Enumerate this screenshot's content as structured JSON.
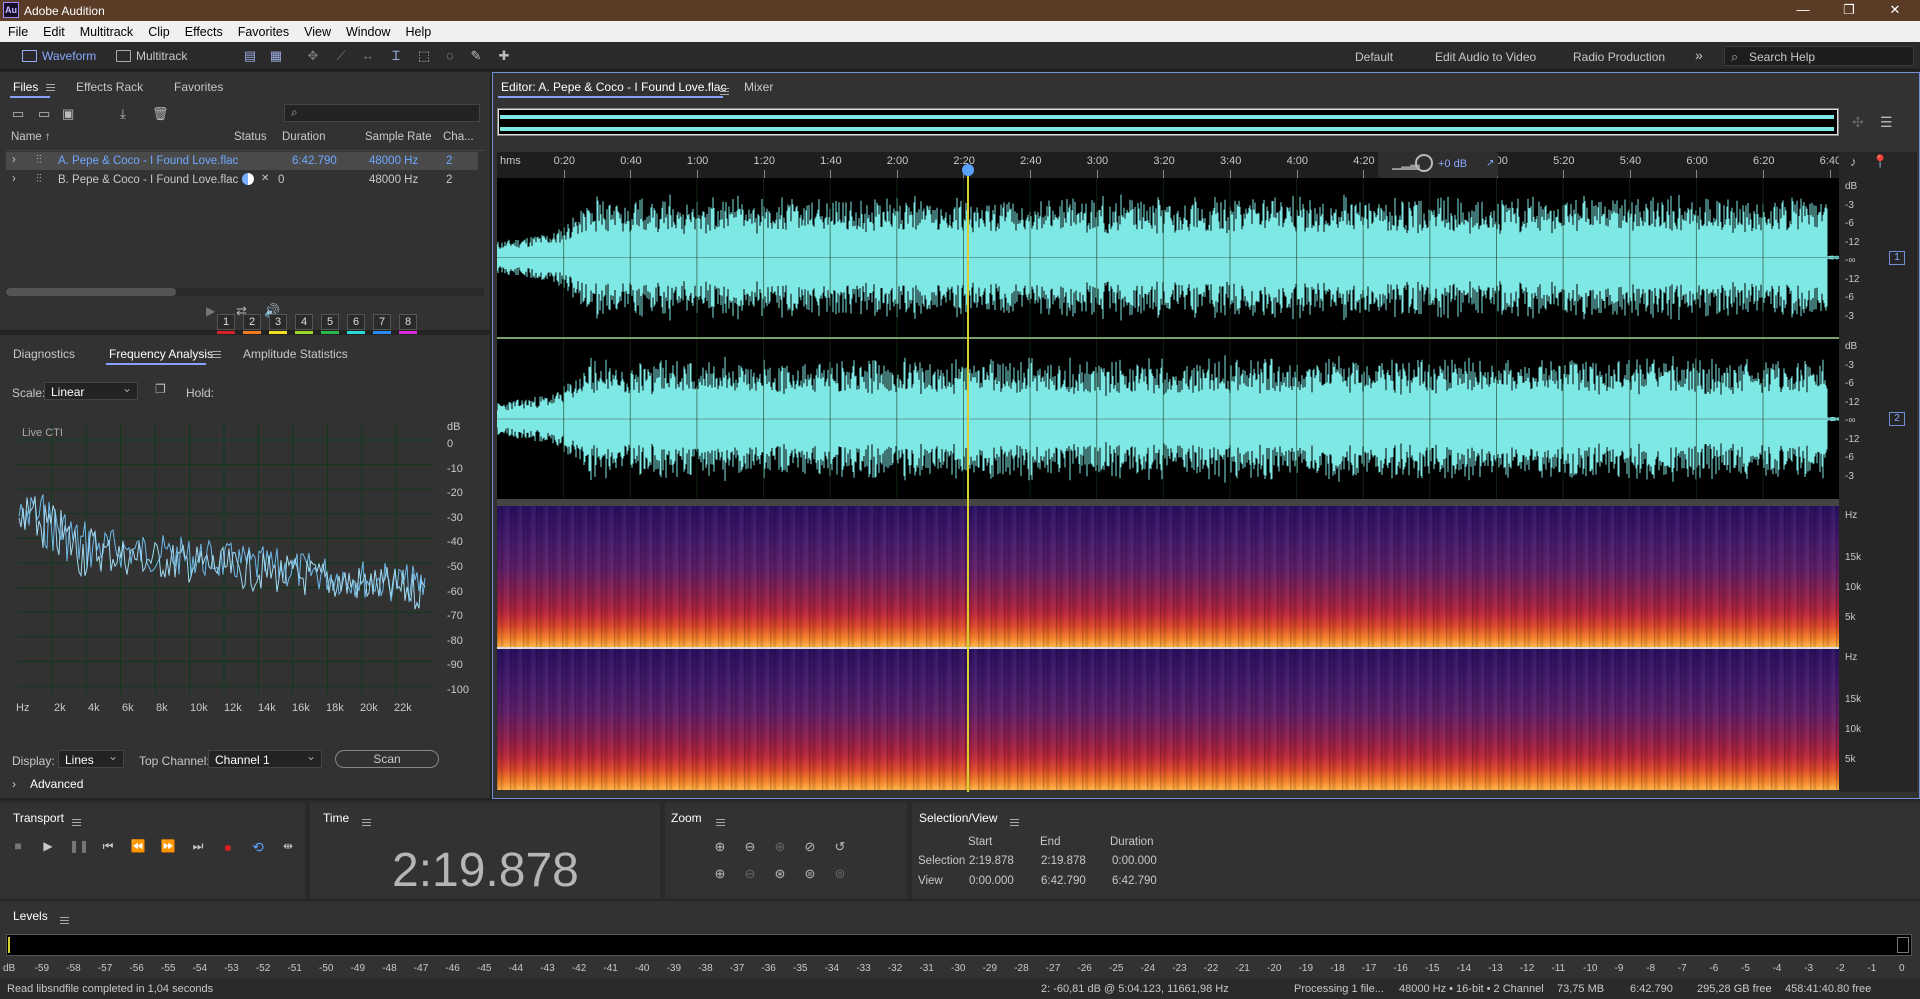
{
  "window": {
    "title": "Adobe Audition",
    "logo": "Au"
  },
  "menu": [
    "File",
    "Edit",
    "Multitrack",
    "Clip",
    "Effects",
    "Favorites",
    "View",
    "Window",
    "Help"
  ],
  "toolbar": {
    "waveform": "Waveform",
    "multitrack": "Multitrack",
    "workspaces": [
      "Default",
      "Edit Audio to Video",
      "Radio Production"
    ],
    "more": "»",
    "search_placeholder": "Search Help"
  },
  "files_panel": {
    "tabs": [
      "Files",
      "Effects Rack",
      "Favorites"
    ],
    "columns": [
      "Name ↑",
      "Status",
      "Duration",
      "Sample Rate",
      "Cha..."
    ],
    "rows": [
      {
        "name": "A. Pepe & Coco - I Found Love.flac",
        "status": "",
        "duration": "6:42.790",
        "sample_rate": "48000 Hz",
        "channels": "2",
        "selected": true
      },
      {
        "name": "B. Pepe & Coco - I Found Love.flac",
        "status": "0",
        "duration": "",
        "sample_rate": "48000 Hz",
        "channels": "2",
        "selected": false
      }
    ]
  },
  "analysis_panel": {
    "tabs": [
      "Diagnostics",
      "Frequency Analysis",
      "Amplitude Statistics"
    ],
    "scale_label": "Scale:",
    "scale_value": "Linear",
    "hold_label": "Hold:",
    "hold_buttons": [
      "1",
      "2",
      "3",
      "4",
      "5",
      "6",
      "7",
      "8"
    ],
    "hold_colors": [
      "#d8202a",
      "#f07a1e",
      "#f0e020",
      "#9ad82a",
      "#2ab84a",
      "#2ad8d8",
      "#2a8af0",
      "#d82ad8"
    ],
    "plot_label": "Live CTI",
    "db_unit": "dB",
    "db_ticks": [
      "0",
      "-10",
      "-20",
      "-30",
      "-40",
      "-50",
      "-60",
      "-70",
      "-80",
      "-90",
      "-100"
    ],
    "hz_ticks": [
      "Hz",
      "2k",
      "4k",
      "6k",
      "8k",
      "10k",
      "12k",
      "14k",
      "16k",
      "18k",
      "20k",
      "22k"
    ],
    "display_label": "Display:",
    "display_value": "Lines",
    "top_channel_label": "Top Channel:",
    "top_channel_value": "Channel 1",
    "scan_button": "Scan",
    "advanced": "Advanced"
  },
  "editor": {
    "tab": "Editor: A. Pepe & Coco - I Found Love.flac",
    "mixer_tab": "Mixer",
    "ruler_unit": "hms",
    "ruler_ticks": [
      "0:20",
      "0:40",
      "1:00",
      "1:20",
      "1:40",
      "2:00",
      "2:20",
      "2:40",
      "3:00",
      "3:20",
      "3:40",
      "4:00",
      "4:20",
      "4:40",
      "5:00",
      "5:20",
      "5:40",
      "6:00",
      "6:20",
      "6:40"
    ],
    "hud_gain": "+0 dB",
    "db_scale": [
      "dB",
      "-3",
      "-6",
      "-12",
      "-∞",
      "-12",
      "-6",
      "-3"
    ],
    "hz_scale": [
      "Hz",
      "15k",
      "10k",
      "5k"
    ],
    "channels": [
      "1",
      "2"
    ],
    "waveform_color": "#7ee8e4",
    "playhead_fraction": 0.35
  },
  "transport": {
    "title": "Transport"
  },
  "time_panel": {
    "title": "Time",
    "value": "2:19.878"
  },
  "zoom_panel": {
    "title": "Zoom"
  },
  "selection_view": {
    "title": "Selection/View",
    "headers": [
      "Start",
      "End",
      "Duration"
    ],
    "selection_label": "Selection",
    "selection": [
      "2:19.878",
      "2:19.878",
      "0:00.000"
    ],
    "view_label": "View",
    "view": [
      "0:00.000",
      "6:42.790",
      "6:42.790"
    ]
  },
  "levels": {
    "title": "Levels",
    "ticks": [
      "dB",
      "-59",
      "-58",
      "-57",
      "-56",
      "-55",
      "-54",
      "-53",
      "-52",
      "-51",
      "-50",
      "-49",
      "-48",
      "-47",
      "-46",
      "-45",
      "-44",
      "-43",
      "-42",
      "-41",
      "-40",
      "-39",
      "-38",
      "-37",
      "-36",
      "-35",
      "-34",
      "-33",
      "-32",
      "-31",
      "-30",
      "-29",
      "-28",
      "-27",
      "-26",
      "-25",
      "-24",
      "-23",
      "-22",
      "-21",
      "-20",
      "-19",
      "-18",
      "-17",
      "-16",
      "-15",
      "-14",
      "-13",
      "-12",
      "-11",
      "-10",
      "-9",
      "-8",
      "-7",
      "-6",
      "-5",
      "-4",
      "-3",
      "-2",
      "-1",
      "0"
    ]
  },
  "status": {
    "left": "Read libsndfile completed in 1,04 seconds",
    "cursor": "2: -60,81 dB @ 5:04.123, 11661,98 Hz",
    "processing": "Processing 1 file...",
    "format": "48000 Hz • 16-bit • 2 Channel",
    "size": "73,75 MB",
    "duration": "6:42.790",
    "free": "295,28 GB free",
    "free_time": "458:41:40.80 free"
  }
}
